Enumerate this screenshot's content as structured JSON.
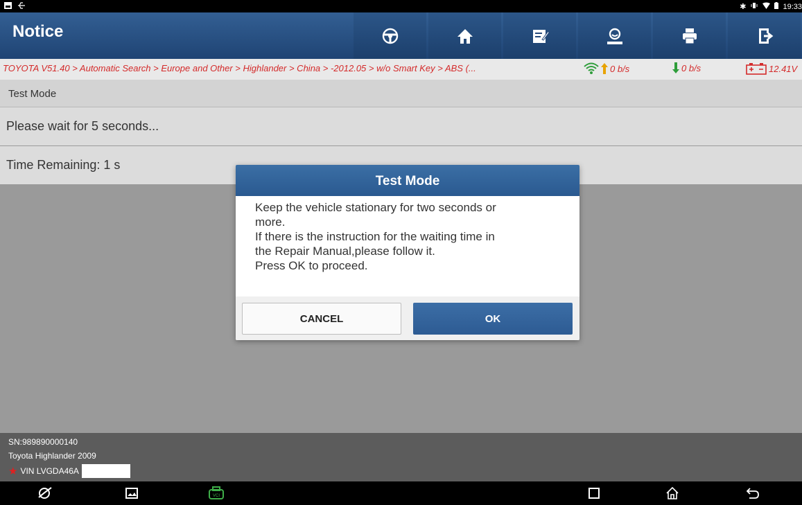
{
  "status_bar": {
    "time": "19:33"
  },
  "header": {
    "title": "Notice",
    "toolbar": [
      {
        "icon": "steering-wheel-icon"
      },
      {
        "icon": "home-icon"
      },
      {
        "icon": "edit-report-icon"
      },
      {
        "icon": "user-icon"
      },
      {
        "icon": "print-icon"
      },
      {
        "icon": "exit-icon"
      }
    ]
  },
  "breadcrumb": {
    "path": "TOYOTA V51.40 > Automatic Search > Europe and Other > Highlander > China > -2012.05 > w/o Smart Key > ABS (...",
    "upload": "0 b/s",
    "download": "0 b/s",
    "battery": "12.41V"
  },
  "content": {
    "section_title": "Test Mode",
    "rows": [
      "Please wait for 5 seconds...",
      "Time Remaining: 1 s"
    ]
  },
  "footer": {
    "sn": "SN:989890000140",
    "vehicle": "Toyota Highlander 2009",
    "vin": "VIN LVGDA46A"
  },
  "dialog": {
    "title": "Test Mode",
    "lines": [
      "Keep the vehicle stationary for two seconds or",
      "more.",
      "If there is the instruction for the waiting time in",
      "the Repair Manual,please follow it.",
      "Press OK to proceed."
    ],
    "cancel_label": "CANCEL",
    "ok_label": "OK"
  },
  "colors": {
    "header_blue": "#2a5990",
    "breadcrumb_red": "#d42a2a",
    "upload_arrow": "#e8a300",
    "download_arrow": "#2e9d3a"
  }
}
